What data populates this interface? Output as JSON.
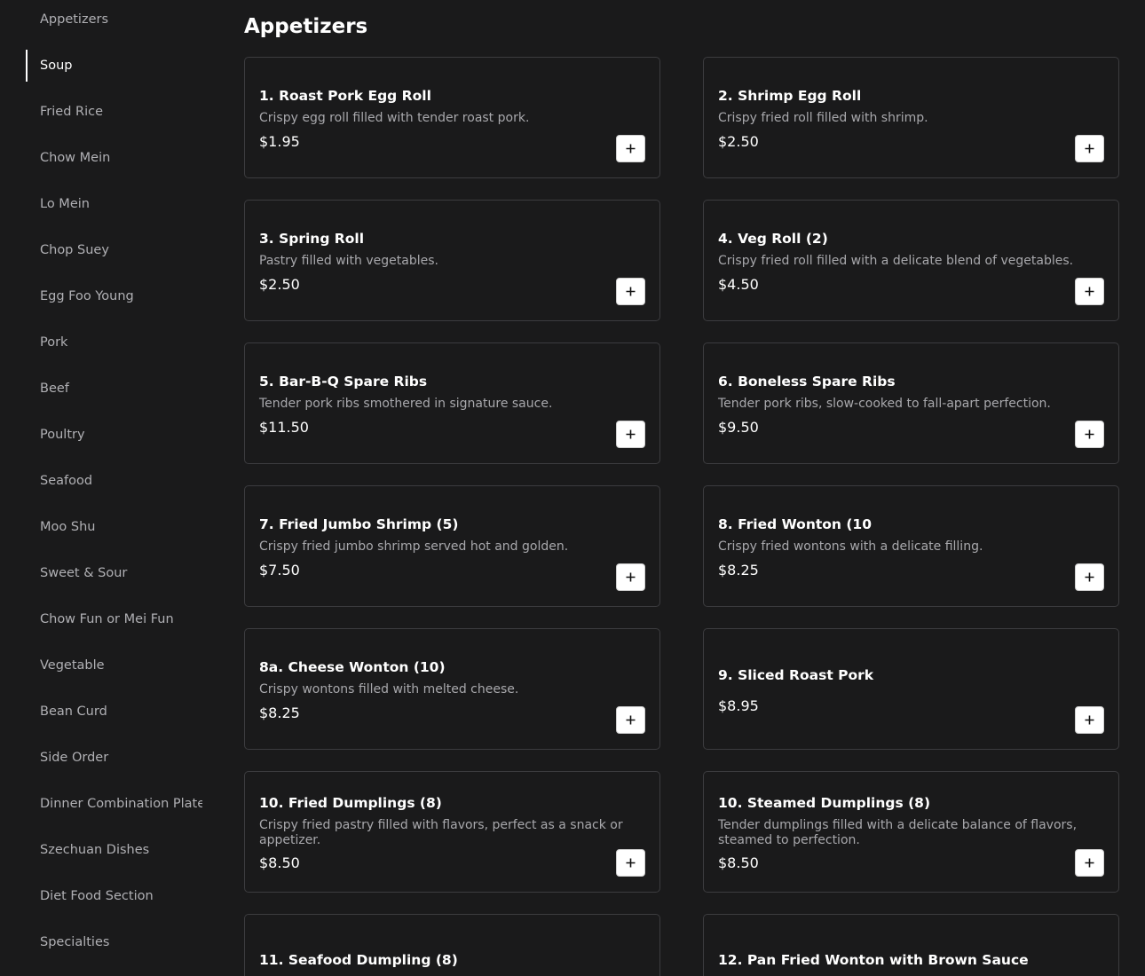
{
  "sidebar": {
    "items": [
      {
        "label": "Appetizers",
        "active": false
      },
      {
        "label": "Soup",
        "active": true
      },
      {
        "label": "Fried Rice",
        "active": false
      },
      {
        "label": "Chow Mein",
        "active": false
      },
      {
        "label": "Lo Mein",
        "active": false
      },
      {
        "label": "Chop Suey",
        "active": false
      },
      {
        "label": "Egg Foo Young",
        "active": false
      },
      {
        "label": "Pork",
        "active": false
      },
      {
        "label": "Beef",
        "active": false
      },
      {
        "label": "Poultry",
        "active": false
      },
      {
        "label": "Seafood",
        "active": false
      },
      {
        "label": "Moo Shu",
        "active": false
      },
      {
        "label": "Sweet & Sour",
        "active": false
      },
      {
        "label": "Chow Fun or Mei Fun",
        "active": false
      },
      {
        "label": "Vegetable",
        "active": false
      },
      {
        "label": "Bean Curd",
        "active": false
      },
      {
        "label": "Side Order",
        "active": false
      },
      {
        "label": "Dinner Combination Plates",
        "active": false
      },
      {
        "label": "Szechuan Dishes",
        "active": false
      },
      {
        "label": "Diet Food Section",
        "active": false
      },
      {
        "label": "Specialties",
        "active": false
      }
    ]
  },
  "main": {
    "section_title": "Appetizers",
    "add_icon": "plus-icon",
    "items": [
      {
        "name": "1. Roast Pork Egg Roll",
        "description": "Crispy egg roll filled with tender roast pork.",
        "price": "$1.95"
      },
      {
        "name": "2. Shrimp Egg Roll",
        "description": "Crispy fried roll filled with shrimp.",
        "price": "$2.50"
      },
      {
        "name": "3. Spring Roll",
        "description": "Pastry filled with vegetables.",
        "price": "$2.50"
      },
      {
        "name": "4. Veg Roll (2)",
        "description": "Crispy fried roll filled with a delicate blend of vegetables.",
        "price": "$4.50"
      },
      {
        "name": "5. Bar-B-Q Spare Ribs",
        "description": "Tender pork ribs smothered in signature sauce.",
        "price": "$11.50"
      },
      {
        "name": "6. Boneless Spare Ribs",
        "description": "Tender pork ribs, slow-cooked to fall-apart perfection.",
        "price": "$9.50"
      },
      {
        "name": "7. Fried Jumbo Shrimp (5)",
        "description": "Crispy fried jumbo shrimp served hot and golden.",
        "price": "$7.50"
      },
      {
        "name": "8. Fried Wonton (10",
        "description": "Crispy fried wontons with a delicate filling.",
        "price": "$8.25"
      },
      {
        "name": "8a. Cheese Wonton (10)",
        "description": "Crispy wontons filled with melted cheese.",
        "price": "$8.25"
      },
      {
        "name": "9. Sliced Roast Pork",
        "description": "",
        "price": "$8.95"
      },
      {
        "name": "10. Fried Dumplings (8)",
        "description": "Crispy fried pastry filled with flavors, perfect as a snack or appetizer.",
        "price": "$8.50"
      },
      {
        "name": "10. Steamed Dumplings (8)",
        "description": "Tender dumplings filled with a delicate balance of flavors, steamed to perfection.",
        "price": "$8.50"
      },
      {
        "name": "11. Seafood Dumpling (8)",
        "description": "",
        "price": ""
      },
      {
        "name": "12. Pan Fried Wonton with Brown Sauce",
        "description": "",
        "price": ""
      }
    ]
  }
}
